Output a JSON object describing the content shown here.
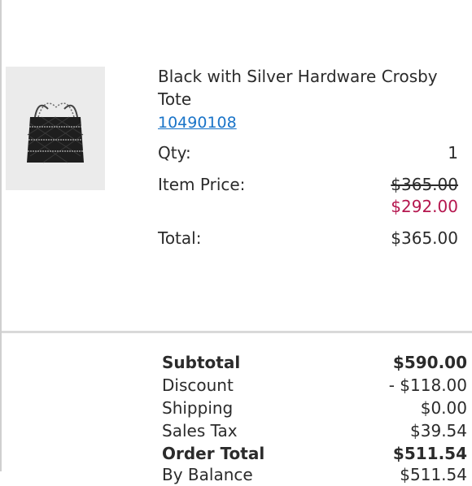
{
  "product": {
    "name": "Black with Silver Hardware Crosby Tote",
    "sku": "10490108",
    "qty_label": "Qty:",
    "qty_value": "1",
    "item_price_label": "Item Price:",
    "original_price": "$365.00",
    "sale_price": "$292.00",
    "total_label": "Total:",
    "total_value": "$365.00",
    "image_icon": "quilted-tote-bag-image"
  },
  "summary": {
    "rows": [
      {
        "label": "Subtotal",
        "value": "$590.00"
      },
      {
        "label": "Discount",
        "value": "- $118.00"
      },
      {
        "label": "Shipping",
        "value": "$0.00"
      },
      {
        "label": "Sales Tax",
        "value": "$39.54"
      },
      {
        "label": "Order Total",
        "value": "$511.54"
      },
      {
        "label": "By Balance",
        "value": "$511.54"
      }
    ]
  },
  "colors": {
    "link": "#1a74c8",
    "sale": "#b5174f",
    "text": "#2b2b2b"
  }
}
